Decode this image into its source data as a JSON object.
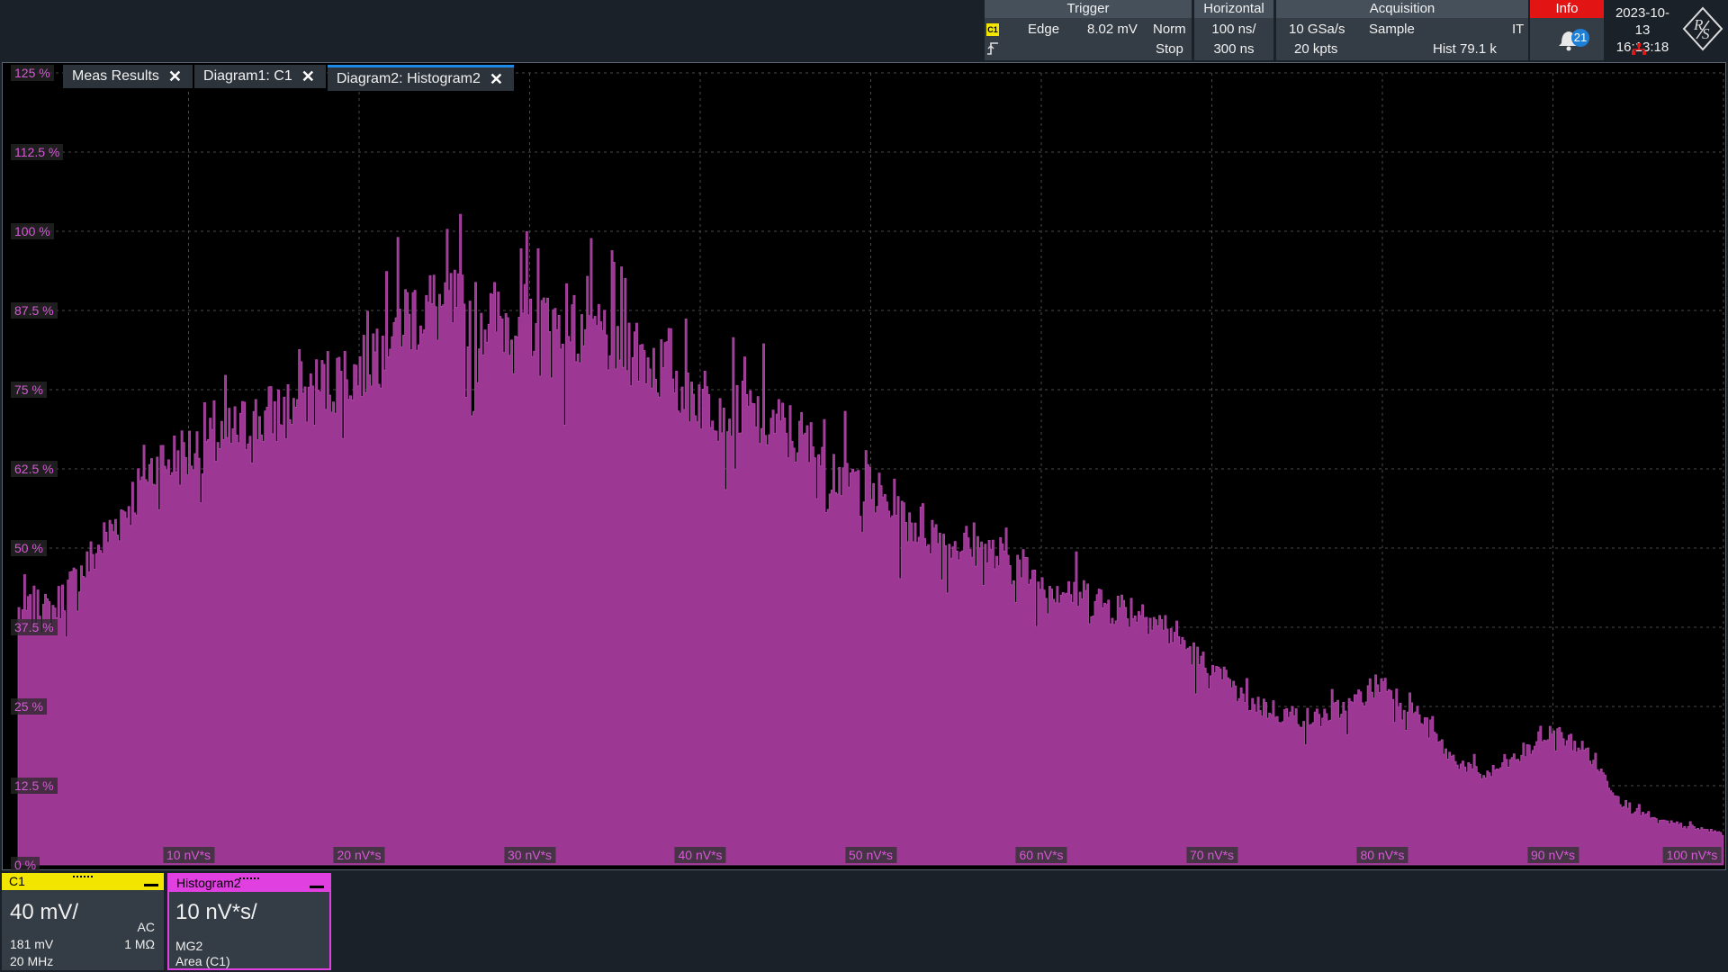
{
  "trigger": {
    "title": "Trigger",
    "channel": "C1",
    "type": "Edge",
    "level": "8.02 mV",
    "mode": "Norm",
    "state": "Stop"
  },
  "horizontal": {
    "title": "Horizontal",
    "scale": "100 ns/",
    "position": "300 ns"
  },
  "acquisition": {
    "title": "Acquisition",
    "sample_rate": "10 GSa/s",
    "mode": "Sample",
    "flag": "IT",
    "record_length": "20 kpts",
    "hist_count": "Hist 79.1 k"
  },
  "info": {
    "title": "Info",
    "notifications": "21"
  },
  "datetime": {
    "date": "2023-10-13",
    "time": "16:13:18"
  },
  "tabs": [
    {
      "label": "Meas Results"
    },
    {
      "label": "Diagram1: C1"
    },
    {
      "label": "Diagram2: Histogram2"
    }
  ],
  "colors": {
    "histogram": "#9c3894",
    "histogram_edge": "#b048a8",
    "c1": "#f2e600",
    "histogram_label": "#e040e0",
    "grid": "#4a4a4a",
    "info": "#e31414",
    "active_tab": "#1e8be8"
  },
  "signals": {
    "c1": {
      "name": "C1",
      "scale": "40 mV/",
      "coupling": "AC",
      "offset": "181 mV",
      "impedance": "1 MΩ",
      "bandwidth": "20 MHz"
    },
    "histogram": {
      "name": "Histogram2",
      "scale": "10 nV*s/",
      "source": "MG2",
      "measurement": "Area (C1)"
    }
  },
  "chart_data": {
    "type": "bar",
    "xlabel": "",
    "ylabel": "",
    "x_unit": "nV*s",
    "xlim": [
      0,
      100
    ],
    "ylim": [
      0,
      125
    ],
    "x_ticks": [
      "10 nV*s",
      "20 nV*s",
      "30 nV*s",
      "40 nV*s",
      "50 nV*s",
      "60 nV*s",
      "70 nV*s",
      "80 nV*s",
      "90 nV*s",
      "100 nV*s"
    ],
    "y_ticks": [
      "0 %",
      "12.5 %",
      "25 %",
      "37.5 %",
      "50 %",
      "62.5 %",
      "75 %",
      "87.5 %",
      "100 %",
      "112.5 %",
      "125 %"
    ],
    "grid": true,
    "envelope": {
      "x": [
        0,
        2,
        4,
        6,
        8,
        10,
        12,
        14,
        16,
        18,
        20,
        22,
        24,
        26,
        28,
        30,
        32,
        34,
        36,
        38,
        40,
        42,
        44,
        46,
        48,
        50,
        52,
        54,
        56,
        58,
        60,
        62,
        64,
        66,
        68,
        70,
        72,
        74,
        76,
        78,
        80,
        82,
        84,
        86,
        88,
        90,
        92,
        94,
        96,
        98,
        100
      ],
      "y": [
        40,
        40,
        47,
        55,
        63,
        65,
        67,
        70,
        72,
        76,
        78,
        86,
        88,
        88,
        86,
        86,
        85,
        84,
        82,
        78,
        74,
        72,
        70,
        67,
        62,
        59,
        55,
        52,
        50,
        48,
        45,
        43,
        41,
        40,
        36,
        30,
        26,
        24,
        23,
        25,
        29,
        24,
        17,
        14,
        17,
        21,
        18,
        10,
        7,
        6,
        5
      ]
    }
  }
}
